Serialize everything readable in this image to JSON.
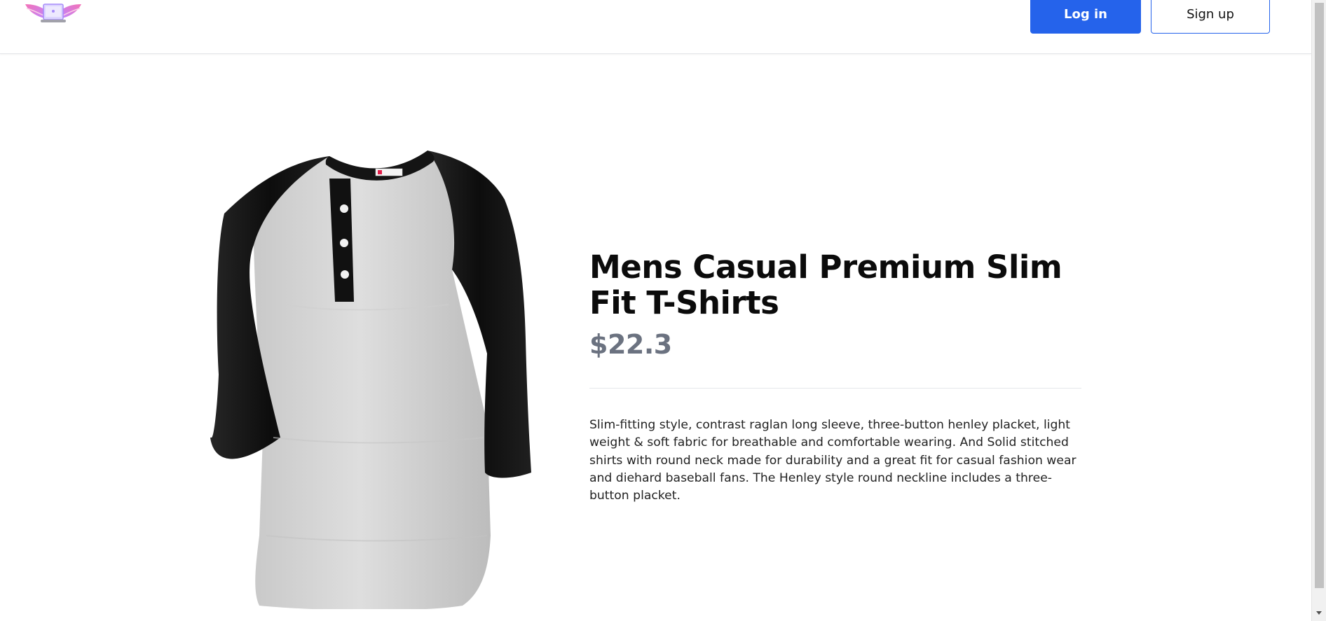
{
  "header": {
    "logo_icon": "winged-laptop-logo",
    "login_label": "Log in",
    "signup_label": "Sign up"
  },
  "product": {
    "image_icon": "henley-raglan-shirt-image",
    "title": "Mens Casual Premium Slim Fit T-Shirts",
    "price": "$22.3",
    "description": "Slim-fitting style, contrast raglan long sleeve, three-button henley placket, light weight & soft fabric for breathable and comfortable wearing. And Solid stitched shirts with round neck made for durability and a great fit for casual fashion wear and diehard baseball fans. The Henley style round neckline includes a three-button placket."
  },
  "colors": {
    "accent": "#2563eb",
    "price": "#6b7280",
    "sleeve": "#111111",
    "body": "#d9d9d9"
  }
}
